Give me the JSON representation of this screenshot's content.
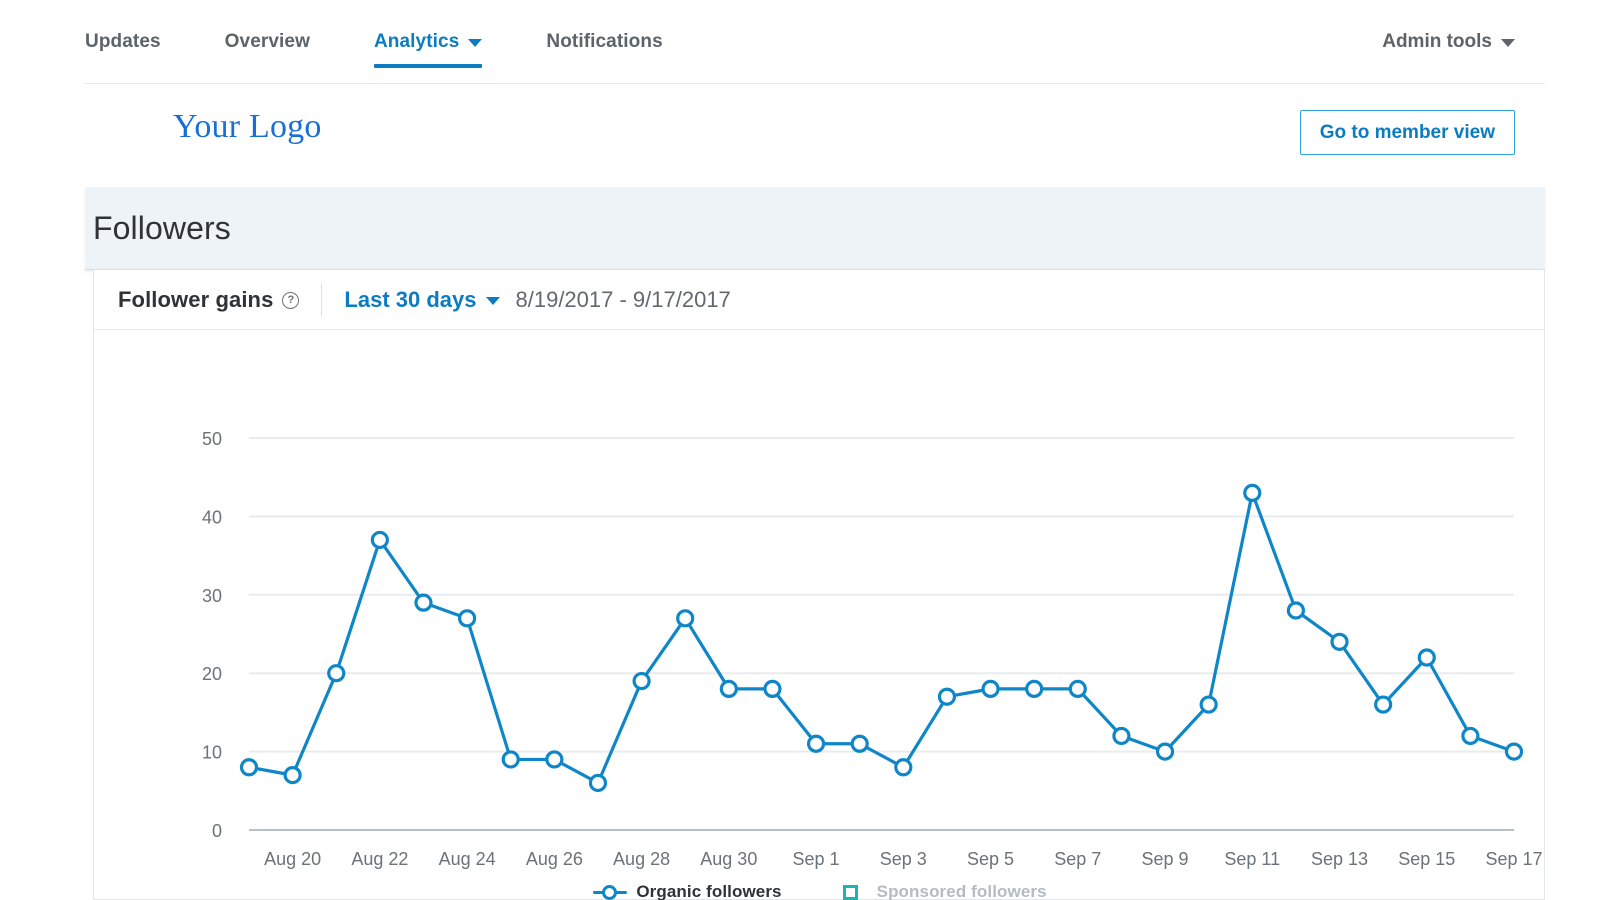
{
  "nav": {
    "items": [
      {
        "label": "Updates",
        "active": false,
        "caret": false
      },
      {
        "label": "Overview",
        "active": false,
        "caret": false
      },
      {
        "label": "Analytics",
        "active": true,
        "caret": true
      },
      {
        "label": "Notifications",
        "active": false,
        "caret": false
      }
    ],
    "admin_tools": "Admin tools"
  },
  "brand": {
    "logo_text": "Your Logo",
    "member_view_button": "Go to member view"
  },
  "section": {
    "title": "Followers"
  },
  "card": {
    "title": "Follower gains",
    "info_icon": "question-mark-icon",
    "range_label": "Last 30 days",
    "date_range": "8/19/2017 - 9/17/2017"
  },
  "colors": {
    "organic": "#0e86c8",
    "sponsored": "#1eb3b0",
    "accent": "#0b7cc1",
    "grid": "#e9ecee",
    "axis": "#b9c0c6",
    "tick_text": "#6b7278"
  },
  "chart_data": {
    "type": "line",
    "title": "Follower gains",
    "xlabel": "",
    "ylabel": "",
    "ylim": [
      0,
      50
    ],
    "yticks": [
      0,
      10,
      20,
      30,
      40,
      50
    ],
    "grid": true,
    "legend_position": "bottom",
    "x": [
      "Aug 19",
      "Aug 20",
      "Aug 21",
      "Aug 22",
      "Aug 23",
      "Aug 24",
      "Aug 25",
      "Aug 26",
      "Aug 27",
      "Aug 28",
      "Aug 29",
      "Aug 30",
      "Aug 31",
      "Sep 1",
      "Sep 2",
      "Sep 3",
      "Sep 4",
      "Sep 5",
      "Sep 6",
      "Sep 7",
      "Sep 8",
      "Sep 9",
      "Sep 10",
      "Sep 11",
      "Sep 12",
      "Sep 13",
      "Sep 14",
      "Sep 15",
      "Sep 16",
      "Sep 17"
    ],
    "xtick_labels": [
      "Aug 20",
      "Aug 22",
      "Aug 24",
      "Aug 26",
      "Aug 28",
      "Aug 30",
      "Sep 1",
      "Sep 3",
      "Sep 5",
      "Sep 7",
      "Sep 9",
      "Sep 11",
      "Sep 13",
      "Sep 15",
      "Sep 17"
    ],
    "xtick_indices": [
      1,
      3,
      5,
      7,
      9,
      11,
      13,
      15,
      17,
      19,
      21,
      23,
      25,
      27,
      29
    ],
    "series": [
      {
        "name": "Organic followers",
        "color": "#0e86c8",
        "marker": "circle",
        "active": true,
        "values": [
          8,
          7,
          20,
          37,
          29,
          27,
          9,
          9,
          6,
          19,
          27,
          18,
          18,
          11,
          11,
          8,
          17,
          18,
          18,
          18,
          12,
          10,
          16,
          43,
          28,
          24,
          16,
          22,
          12,
          10
        ]
      },
      {
        "name": "Sponsored followers",
        "color": "#1eb3b0",
        "marker": "square",
        "active": false,
        "values": []
      }
    ]
  }
}
